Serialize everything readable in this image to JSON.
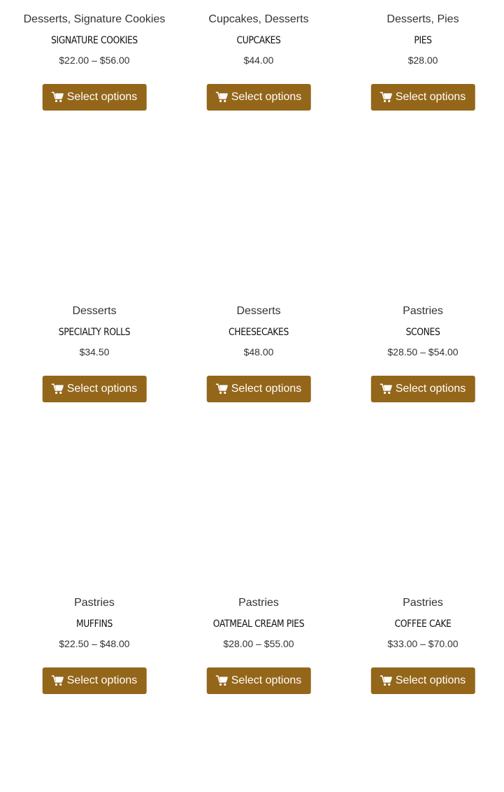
{
  "colors": {
    "button_bg": "#94661a",
    "button_text": "#ffffff",
    "text": "#333333"
  },
  "products": [
    {
      "categories": "Desserts, Signature Cookies",
      "title": "SIGNATURE COOKIES",
      "price": "$22.00 – $56.00",
      "button_label": "Select options",
      "button_icon": "cart-icon"
    },
    {
      "categories": "Cupcakes, Desserts",
      "title": "CUPCAKES",
      "price": "$44.00",
      "button_label": "Select options",
      "button_icon": "cart-icon"
    },
    {
      "categories": "Desserts, Pies",
      "title": "PIES",
      "price": "$28.00",
      "button_label": "Select options",
      "button_icon": "cart-icon"
    },
    {
      "categories": "Desserts",
      "title": "SPECIALTY ROLLS",
      "price": "$34.50",
      "button_label": "Select options",
      "button_icon": "cart-icon"
    },
    {
      "categories": "Desserts",
      "title": "CHEESECAKES",
      "price": "$48.00",
      "button_label": "Select options",
      "button_icon": "cart-icon"
    },
    {
      "categories": "Pastries",
      "title": "SCONES",
      "price": "$28.50 – $54.00",
      "button_label": "Select options",
      "button_icon": "cart-icon"
    },
    {
      "categories": "Pastries",
      "title": "MUFFINS",
      "price": "$22.50 – $48.00",
      "button_label": "Select options",
      "button_icon": "cart-icon"
    },
    {
      "categories": "Pastries",
      "title": "OATMEAL CREAM PIES",
      "price": "$28.00 – $55.00",
      "button_label": "Select options",
      "button_icon": "cart-icon"
    },
    {
      "categories": "Pastries",
      "title": "COFFEE CAKE",
      "price": "$33.00 – $70.00",
      "button_label": "Select options",
      "button_icon": "cart-icon"
    }
  ]
}
